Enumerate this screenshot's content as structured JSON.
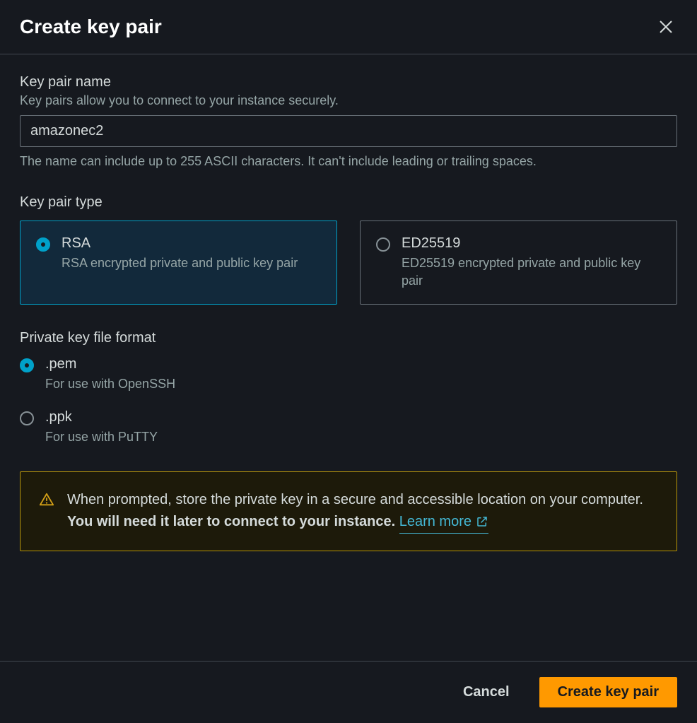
{
  "header": {
    "title": "Create key pair"
  },
  "name_section": {
    "label": "Key pair name",
    "hint": "Key pairs allow you to connect to your instance securely.",
    "value": "amazonec2",
    "help": "The name can include up to 255 ASCII characters. It can't include leading or trailing spaces."
  },
  "type_section": {
    "label": "Key pair type",
    "options": [
      {
        "title": "RSA",
        "desc": "RSA encrypted private and public key pair",
        "selected": true
      },
      {
        "title": "ED25519",
        "desc": "ED25519 encrypted private and public key pair",
        "selected": false
      }
    ]
  },
  "format_section": {
    "label": "Private key file format",
    "options": [
      {
        "title": ".pem",
        "desc": "For use with OpenSSH",
        "selected": true
      },
      {
        "title": ".ppk",
        "desc": "For use with PuTTY",
        "selected": false
      }
    ]
  },
  "warning": {
    "text_before": "When prompted, store the private key in a secure and accessible location on your computer. ",
    "text_bold": "You will need it later to connect to your instance.",
    "link_label": "Learn more"
  },
  "footer": {
    "cancel": "Cancel",
    "submit": "Create key pair"
  }
}
